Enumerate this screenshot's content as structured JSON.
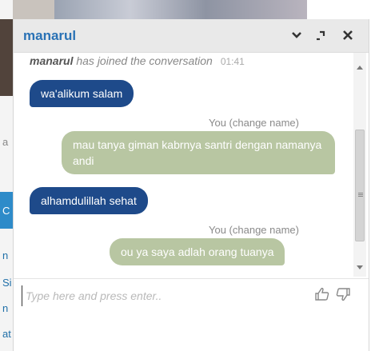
{
  "chat": {
    "agent_name": "manarul",
    "header_icons": [
      "minimize-icon",
      "popout-icon",
      "close-icon"
    ],
    "system_message": {
      "name": "manarul",
      "text": " has joined the conversation",
      "time": "01:41"
    },
    "messages": [
      {
        "from": "agent",
        "text": "wa'alikum salam"
      },
      {
        "from": "visitor",
        "sender": "You (change name)",
        "text": "mau tanya giman kabrnya santri dengan namanya andi"
      },
      {
        "from": "agent",
        "text": "alhamdulillah sehat"
      },
      {
        "from": "visitor",
        "sender": "You (change name)",
        "text": "ou ya saya adlah orang tuanya"
      }
    ],
    "composer": {
      "placeholder": "Type here and press enter..",
      "value": ""
    },
    "rating_icons": [
      "thumbs-up-icon",
      "thumbs-down-icon"
    ]
  },
  "background": {
    "left_letters": [
      "a",
      "C",
      "n",
      "Si",
      "n",
      "at"
    ]
  },
  "colors": {
    "agent_bubble": "#1e4a8a",
    "visitor_bubble": "#b8c6a2",
    "agent_name": "#2a72b5",
    "header_bg": "#e9e9e9"
  }
}
